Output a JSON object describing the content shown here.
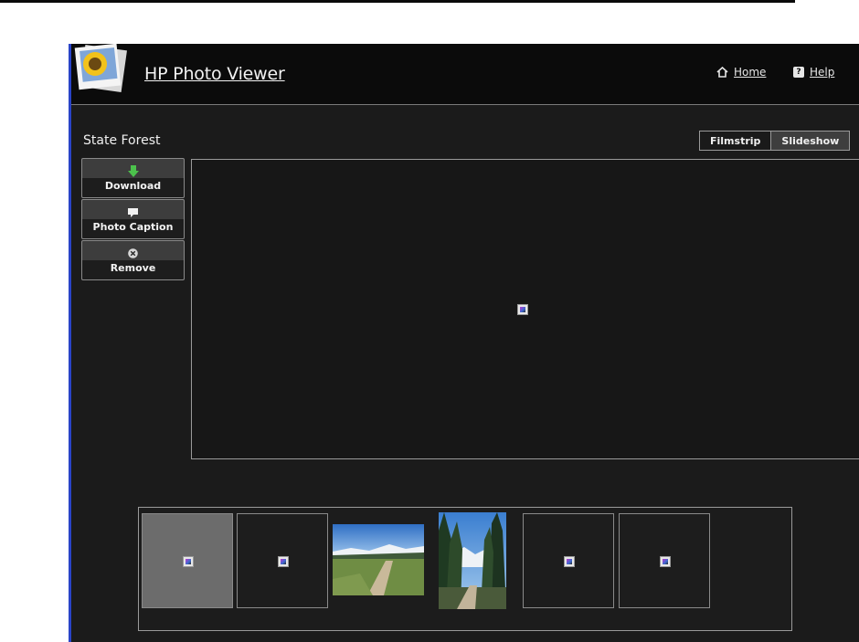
{
  "header": {
    "title": "HP Photo Viewer",
    "links": {
      "home": "Home",
      "help": "Help"
    }
  },
  "album": {
    "title": "State Forest"
  },
  "view_toggle": {
    "filmstrip": "Filmstrip",
    "slideshow": "Slideshow",
    "active": "slideshow"
  },
  "actions": {
    "download": "Download",
    "photo_caption": "Photo Caption",
    "remove": "Remove"
  },
  "icons": {
    "logo": "sunflower-photo-icon",
    "home": "home-icon",
    "help": "help-icon",
    "download": "download-arrow-icon",
    "caption": "speech-bubble-icon",
    "remove": "close-circle-icon",
    "placeholder": "broken-image-icon"
  },
  "colors": {
    "frame_accent": "#2a44c8",
    "download_arrow": "#4cc24c",
    "background": "#1b1b1b"
  },
  "filmstrip": {
    "thumbnails": [
      {
        "kind": "placeholder",
        "selected": true
      },
      {
        "kind": "placeholder",
        "selected": false
      },
      {
        "kind": "photo-landscape",
        "selected": false
      },
      {
        "kind": "photo-forest",
        "selected": false
      },
      {
        "kind": "placeholder",
        "selected": false
      },
      {
        "kind": "placeholder",
        "selected": false
      }
    ]
  }
}
